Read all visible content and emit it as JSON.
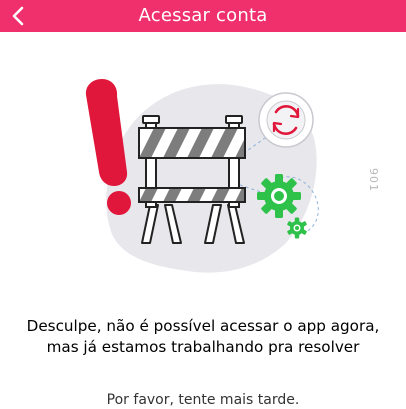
{
  "header": {
    "title": "Acessar conta",
    "background": "#f0306c",
    "back_icon": "chevron-left-icon"
  },
  "illustration": {
    "exclamation_color": "#e0163a",
    "gear_color": "#2fc24a",
    "refresh_icon_color": "#e0163a",
    "code": "901"
  },
  "message": {
    "text": "Desculpe, não é possível acessar o app agora, mas já estamos trabalhando pra resolver",
    "hint": "Por favor, tente mais tarde."
  }
}
